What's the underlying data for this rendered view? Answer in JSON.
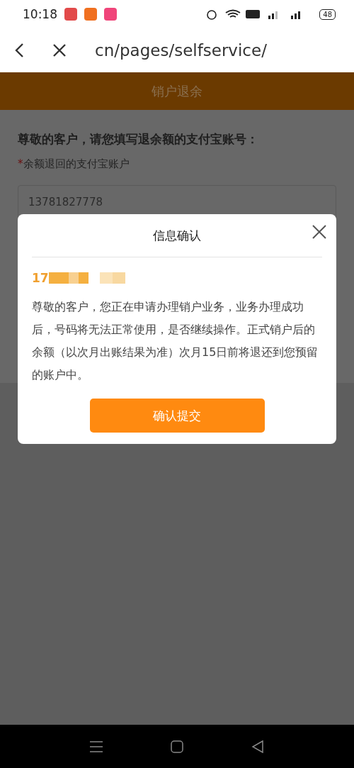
{
  "status_bar": {
    "time": "10:18",
    "battery": "48"
  },
  "browser": {
    "url": "cn/pages/selfservice/"
  },
  "header": {
    "title": "销户退余"
  },
  "form": {
    "heading": "尊敬的客户，请您填写退余额的支付宝账号：",
    "field_label": "余额退回的支付宝账户",
    "required_mark": "*",
    "value": "13781827778"
  },
  "dialog": {
    "title": "信息确认",
    "number_prefix": "17",
    "message": "尊敬的客户，您正在申请办理销户业务，业务办理成功后，号码将无法正常使用，是否继续操作。正式销户后的余额（以次月出账结果为准）次月15日前将退还到您预留的账户中。",
    "confirm_button": "确认提交"
  }
}
